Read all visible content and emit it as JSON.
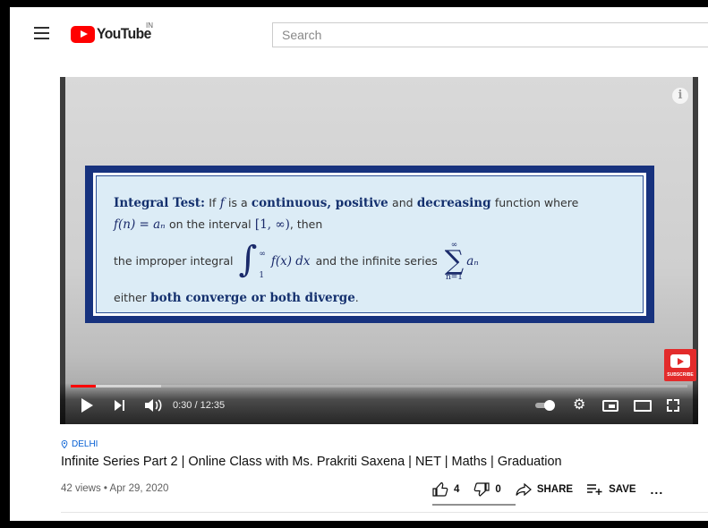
{
  "header": {
    "logo_text": "YouTube",
    "country": "IN",
    "search_placeholder": "Search"
  },
  "player": {
    "slide": {
      "heading": "Integral Test:",
      "line1_a": "If",
      "line1_f": "f",
      "line1_b": "is a",
      "line1_c": "continuous, positive",
      "line1_d": "and",
      "line1_e": "decreasing",
      "line1_g": "function where",
      "line2_math": "f(n) = aₙ",
      "line2_a": "on the interval",
      "line2_interval": "[1, ∞)",
      "line2_b": ", then",
      "line3_a": "the improper integral",
      "integral_upper": "∞",
      "integral_lower": "1",
      "integrand": "f(x) dx",
      "line3_b": "and the infinite series",
      "sum_upper": "∞",
      "sum_lower": "n=1",
      "sum_term": "aₙ",
      "line4_a": "either",
      "line4_b": "both converge or both diverge",
      "line4_c": "."
    },
    "subscribe_label": "SUBSCRIBE",
    "time": "0:30 / 12:35",
    "played_fraction": 0.04,
    "buffered_fraction": 0.147,
    "info_glyph": "i",
    "icons": [
      "play-icon",
      "next-icon",
      "volume-icon",
      "autoplay-toggle-icon",
      "gear-icon",
      "miniplayer-icon",
      "theater-icon",
      "fullscreen-icon"
    ]
  },
  "meta": {
    "location": "DELHI",
    "title": "Infinite Series Part 2 | Online Class with Ms. Prakriti Saxena | NET | Maths | Graduation",
    "views": "42 views • Apr 29, 2020",
    "likes": "4",
    "dislikes": "0",
    "share": "SHARE",
    "save": "SAVE",
    "more": "..."
  },
  "colors": {
    "brand_red": "#ff0000",
    "link_blue": "#065fd4",
    "slide_border": "#17327e",
    "slide_bg": "#dcecf6"
  }
}
